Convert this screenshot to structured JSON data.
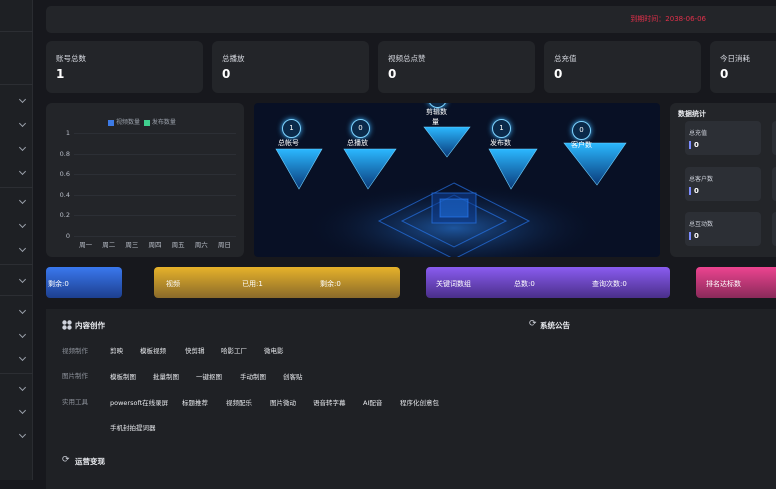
{
  "header": {
    "expire_text": "到期时间：2038-06-06"
  },
  "stats": [
    {
      "label": "账号总数",
      "value": "1"
    },
    {
      "label": "总播放",
      "value": "0"
    },
    {
      "label": "视频总点赞",
      "value": "0"
    },
    {
      "label": "总充值",
      "value": "0"
    },
    {
      "label": "今日消耗",
      "value": "0"
    }
  ],
  "chart_data": {
    "type": "bar",
    "categories": [
      "周一",
      "周二",
      "周三",
      "周四",
      "周五",
      "周六",
      "周日"
    ],
    "series": [
      {
        "name": "视频数量",
        "values": [
          0,
          0,
          0,
          0,
          0,
          0,
          0
        ]
      },
      {
        "name": "发布数量",
        "values": [
          0,
          0,
          0,
          0,
          0,
          0,
          0
        ]
      }
    ],
    "yticks": [
      "1",
      "0.8",
      "0.6",
      "0.4",
      "0.2",
      "0"
    ],
    "ylim": [
      0,
      1
    ],
    "legend_position": "top-center",
    "grid": true,
    "colors": [
      "#3d7be6",
      "#3fcf8e"
    ]
  },
  "hero": {
    "nodes": [
      {
        "value": "1",
        "label": "总帐号"
      },
      {
        "value": "0",
        "label": "总播放"
      },
      {
        "value": "0",
        "label": "剪辑数"
      },
      {
        "value": "1",
        "label": "发布数"
      },
      {
        "value": "0",
        "label": "客户数"
      }
    ],
    "node_label_extra": "量"
  },
  "data_stats": {
    "title": "数据统计",
    "cards": [
      {
        "label": "总充值",
        "value": "0"
      },
      {
        "label": "总客户数",
        "value": "0"
      },
      {
        "label": "总互动数",
        "value": "0"
      }
    ]
  },
  "banners": {
    "blue": {
      "text": "剩余:0",
      "color": "#2d63d6"
    },
    "yellow": {
      "title": "视频",
      "used": "已用:1",
      "remaining": "剩余:0",
      "color": "#d9a322"
    },
    "purple": {
      "title": "关键词数组",
      "total": "总数:0",
      "queries": "查询次数:0",
      "color": "#7b4fe0"
    },
    "pink": {
      "title": "排名达标数",
      "color": "#e0357f"
    }
  },
  "content": {
    "title": "内容创作",
    "announce_title": "系统公告",
    "ops_title": "运营变现",
    "rows": [
      {
        "label": "视频制作",
        "items": [
          "剪映",
          "模板视频",
          "快剪辑",
          "哈影工厂",
          "微电影"
        ]
      },
      {
        "label": "图片制作",
        "items": [
          "模板制图",
          "批量制图",
          "一键抠图",
          "手动制图",
          "创客贴"
        ]
      },
      {
        "label": "实用工具",
        "items": [
          "powersoft在线录屏",
          "标题推荐",
          "视频配乐",
          "图片微动",
          "语音转字幕",
          "AI配音",
          "程序化创意包"
        ]
      }
    ],
    "extra_tool": "手机封拍提词器"
  }
}
